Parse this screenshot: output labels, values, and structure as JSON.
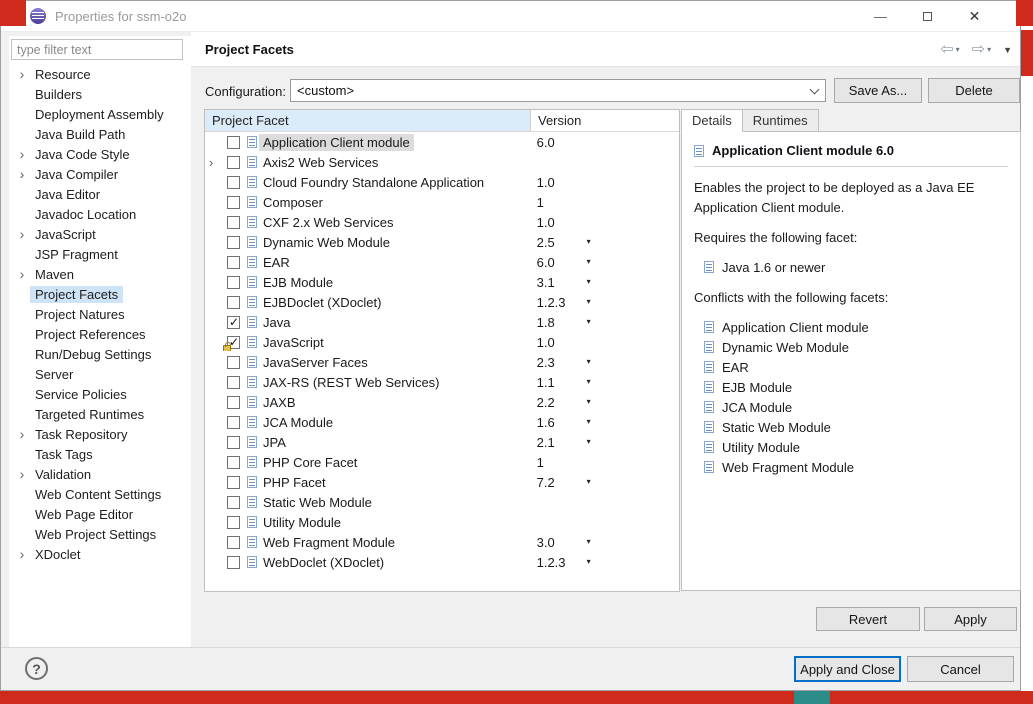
{
  "window": {
    "title": "Properties for ssm-o2o"
  },
  "icons": {
    "back": "⇦",
    "forward": "⇨",
    "dropdown_small": "▾",
    "menu_dropdown": "▼",
    "chevron": "›",
    "minimize": "—",
    "close": "✕"
  },
  "sidebar": {
    "filter_placeholder": "type filter text",
    "items": [
      {
        "label": "Resource",
        "chevron": true
      },
      {
        "label": "Builders"
      },
      {
        "label": "Deployment Assembly"
      },
      {
        "label": "Java Build Path"
      },
      {
        "label": "Java Code Style",
        "chevron": true
      },
      {
        "label": "Java Compiler",
        "chevron": true
      },
      {
        "label": "Java Editor"
      },
      {
        "label": "Javadoc Location"
      },
      {
        "label": "JavaScript",
        "chevron": true
      },
      {
        "label": "JSP Fragment"
      },
      {
        "label": "Maven",
        "chevron": true
      },
      {
        "label": "Project Facets",
        "selected": true
      },
      {
        "label": "Project Natures"
      },
      {
        "label": "Project References"
      },
      {
        "label": "Run/Debug Settings"
      },
      {
        "label": "Server"
      },
      {
        "label": "Service Policies"
      },
      {
        "label": "Targeted Runtimes"
      },
      {
        "label": "Task Repository",
        "chevron": true
      },
      {
        "label": "Task Tags"
      },
      {
        "label": "Validation",
        "chevron": true
      },
      {
        "label": "Web Content Settings"
      },
      {
        "label": "Web Page Editor"
      },
      {
        "label": "Web Project Settings"
      },
      {
        "label": "XDoclet",
        "chevron": true
      }
    ]
  },
  "header": {
    "title": "Project Facets"
  },
  "configuration": {
    "label": "Configuration:",
    "value": "<custom>",
    "save_as_label": "Save As...",
    "delete_label": "Delete"
  },
  "facet_table": {
    "columns": [
      "Project Facet",
      "Version"
    ],
    "rows": [
      {
        "label": "Application Client module",
        "version": "6.0",
        "selected": true
      },
      {
        "label": "Axis2 Web Services",
        "version": "",
        "expandable": true
      },
      {
        "label": "Cloud Foundry Standalone Application",
        "version": "1.0"
      },
      {
        "label": "Composer",
        "version": "1"
      },
      {
        "label": "CXF 2.x Web Services",
        "version": "1.0"
      },
      {
        "label": "Dynamic Web Module",
        "version": "2.5",
        "version_dropdown": true
      },
      {
        "label": "EAR",
        "version": "6.0",
        "version_dropdown": true
      },
      {
        "label": "EJB Module",
        "version": "3.1",
        "version_dropdown": true
      },
      {
        "label": "EJBDoclet (XDoclet)",
        "version": "1.2.3",
        "version_dropdown": true
      },
      {
        "label": "Java",
        "version": "1.8",
        "checked": true,
        "version_dropdown": true
      },
      {
        "label": "JavaScript",
        "version": "1.0",
        "checked": true,
        "locked": true
      },
      {
        "label": "JavaServer Faces",
        "version": "2.3",
        "version_dropdown": true
      },
      {
        "label": "JAX-RS (REST Web Services)",
        "version": "1.1",
        "version_dropdown": true
      },
      {
        "label": "JAXB",
        "version": "2.2",
        "version_dropdown": true
      },
      {
        "label": "JCA Module",
        "version": "1.6",
        "version_dropdown": true
      },
      {
        "label": "JPA",
        "version": "2.1",
        "version_dropdown": true
      },
      {
        "label": "PHP Core Facet",
        "version": "1"
      },
      {
        "label": "PHP Facet",
        "version": "7.2",
        "version_dropdown": true
      },
      {
        "label": "Static Web Module",
        "version": ""
      },
      {
        "label": "Utility Module",
        "version": ""
      },
      {
        "label": "Web Fragment Module",
        "version": "3.0",
        "version_dropdown": true
      },
      {
        "label": "WebDoclet (XDoclet)",
        "version": "1.2.3",
        "version_dropdown": true
      }
    ]
  },
  "details_panel": {
    "tabs": [
      {
        "label": "Details",
        "active": true
      },
      {
        "label": "Runtimes",
        "active": false
      }
    ],
    "title": "Application Client module 6.0",
    "description": "Enables the project to be deployed as a Java EE Application Client module.",
    "requires_heading": "Requires the following facet:",
    "requires": [
      "Java 1.6 or newer"
    ],
    "conflicts_heading": "Conflicts with the following facets:",
    "conflicts": [
      "Application Client module",
      "Dynamic Web Module",
      "EAR",
      "EJB Module",
      "JCA Module",
      "Static Web Module",
      "Utility Module",
      "Web Fragment Module"
    ]
  },
  "actions": {
    "revert": "Revert",
    "apply": "Apply",
    "apply_and_close": "Apply and Close",
    "cancel": "Cancel",
    "help": "?"
  }
}
